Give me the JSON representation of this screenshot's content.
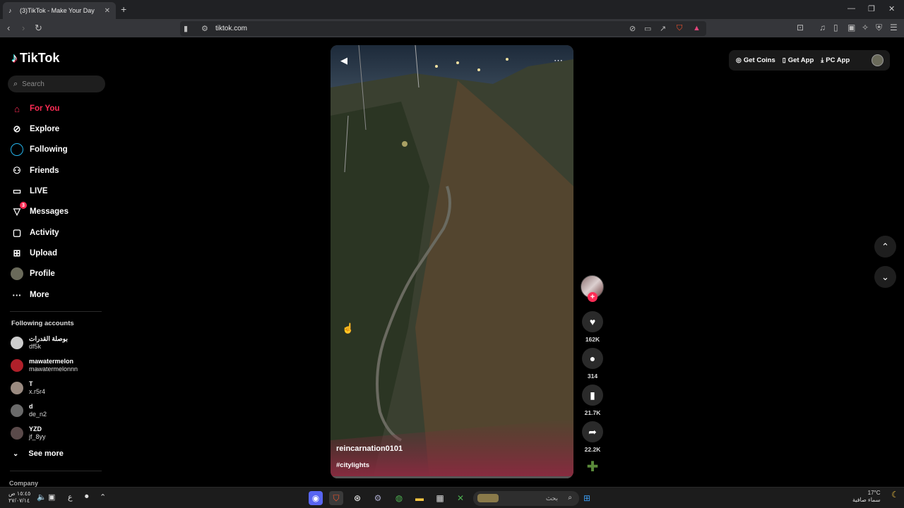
{
  "browser": {
    "tab_title": "(3)TikTok - Make Your Day",
    "url": "tiktok.com",
    "new_tab": "+"
  },
  "sidebar": {
    "logo": "TikTok",
    "search_placeholder": "Search",
    "items": [
      {
        "label": "For You",
        "icon": "home-icon"
      },
      {
        "label": "Explore",
        "icon": "compass-icon"
      },
      {
        "label": "Following",
        "icon": "following-icon"
      },
      {
        "label": "Friends",
        "icon": "friends-icon"
      },
      {
        "label": "LIVE",
        "icon": "live-icon"
      },
      {
        "label": "Messages",
        "icon": "messages-icon",
        "badge": "3"
      },
      {
        "label": "Activity",
        "icon": "activity-icon"
      },
      {
        "label": "Upload",
        "icon": "upload-icon"
      },
      {
        "label": "Profile",
        "icon": "profile-avatar"
      },
      {
        "label": "More",
        "icon": "more-icon"
      }
    ],
    "following_title": "Following accounts",
    "accounts": [
      {
        "name": "بوصلة القدرات",
        "handle": "df5k"
      },
      {
        "name": "mawatermelon",
        "handle": "mawatermelonnn"
      },
      {
        "name": "T",
        "handle": "x.r5r4"
      },
      {
        "name": "d",
        "handle": "de_n2"
      },
      {
        "name": "YZD",
        "handle": "jf_8yy"
      }
    ],
    "see_more": "See more",
    "company": "Company"
  },
  "video": {
    "username": "reincarnation0101",
    "hashtag": "#citylights"
  },
  "actions": {
    "likes": "162K",
    "comments": "314",
    "saves": "21.7K",
    "shares": "22.2K"
  },
  "topright": {
    "get_coins": "Get Coins",
    "get_app": "Get App",
    "pc_app": "PC App"
  },
  "taskbar": {
    "time": "١٥:٤٥ ص",
    "date": "٢٧/٠٧/١٤",
    "search_text": "بحث",
    "temp": "17°C",
    "weather": "سماء صافية"
  },
  "colors": {
    "accent": "#fe2c55",
    "background": "#000000"
  }
}
